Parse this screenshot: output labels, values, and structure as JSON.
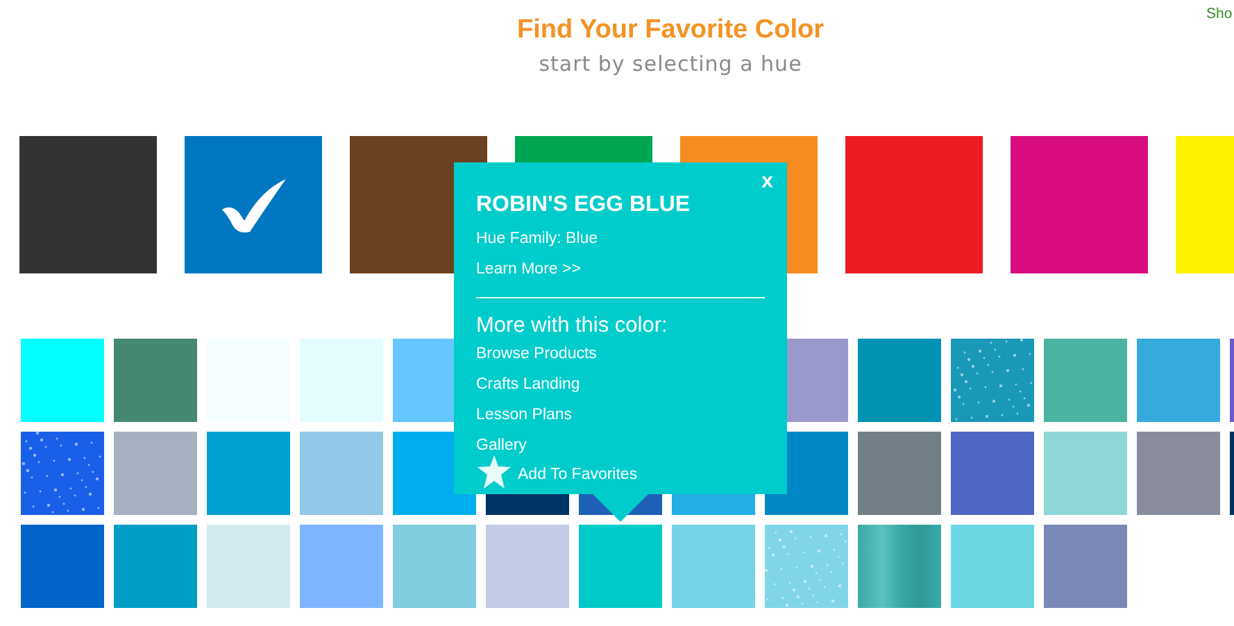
{
  "header": {
    "title": "Find Your Favorite Color",
    "subtitle": "start by selecting a hue",
    "corner_link": "Sho"
  },
  "hues": [
    {
      "color": "#333333",
      "selected": false
    },
    {
      "color": "#0077c0",
      "selected": true
    },
    {
      "color": "#6b4220",
      "selected": false
    },
    {
      "color": "#00a651",
      "selected": false
    },
    {
      "color": "#f68b1f",
      "selected": false
    },
    {
      "color": "#ed1c24",
      "selected": false
    },
    {
      "color": "#d80c80",
      "selected": false
    },
    {
      "color": "#fff200",
      "selected": false
    }
  ],
  "shades": [
    [
      {
        "kind": "solid",
        "color": "#00ffff"
      },
      {
        "kind": "solid",
        "color": "#448870"
      },
      {
        "kind": "solid",
        "color": "#f5feff"
      },
      {
        "kind": "solid",
        "color": "#e3fdff"
      },
      {
        "kind": "solid",
        "color": "#66c6ff"
      },
      {
        "kind": "covered"
      },
      {
        "kind": "covered"
      },
      {
        "kind": "covered"
      },
      {
        "kind": "solid",
        "color": "#9999cc"
      },
      {
        "kind": "solid",
        "color": "#0093b4"
      },
      {
        "kind": "glitter",
        "color": "#1a98b8"
      },
      {
        "kind": "solid",
        "color": "#4bb3a2"
      },
      {
        "kind": "solid",
        "color": "#36aadd"
      },
      {
        "kind": "solid",
        "color": "#6a5acd"
      }
    ],
    [
      {
        "kind": "glitter",
        "color": "#1a5fe8"
      },
      {
        "kind": "solid",
        "color": "#a6b0c0"
      },
      {
        "kind": "solid",
        "color": "#00a0d2"
      },
      {
        "kind": "solid",
        "color": "#92c8e8"
      },
      {
        "kind": "solid",
        "color": "#00aeef"
      },
      {
        "kind": "solid",
        "color": "#003366"
      },
      {
        "kind": "solid",
        "color": "#1e5fb8"
      },
      {
        "kind": "solid",
        "color": "#22aee6"
      },
      {
        "kind": "solid",
        "color": "#0088c6"
      },
      {
        "kind": "solid",
        "color": "#737f86"
      },
      {
        "kind": "solid",
        "color": "#4f67c4"
      },
      {
        "kind": "solid",
        "color": "#8fd6d6"
      },
      {
        "kind": "solid",
        "color": "#898c9c"
      },
      {
        "kind": "solid",
        "color": "#003060"
      }
    ],
    [
      {
        "kind": "solid",
        "color": "#0064c8"
      },
      {
        "kind": "solid",
        "color": "#009ec6"
      },
      {
        "kind": "solid",
        "color": "#d2ebf0"
      },
      {
        "kind": "solid",
        "color": "#7fb5ff"
      },
      {
        "kind": "solid",
        "color": "#80cde0"
      },
      {
        "kind": "solid",
        "color": "#c2cbe4"
      },
      {
        "kind": "solid",
        "color": "#00cbc8",
        "popup": {
          "title": "ROBIN'S EGG BLUE",
          "close": "x",
          "hue_family": "Hue Family: Blue",
          "learn_more": "Learn More >>",
          "more_heading": "More with this color:",
          "links": [
            "Browse Products",
            "Crafts Landing",
            "Lesson Plans",
            "Gallery"
          ],
          "favorite": "Add To Favorites"
        }
      },
      {
        "kind": "solid",
        "color": "#74d3e6"
      },
      {
        "kind": "glitter",
        "color": "#80d6e8"
      },
      {
        "kind": "metallic",
        "color": "#39aaa8"
      },
      {
        "kind": "solid",
        "color": "#6ad7e3"
      },
      {
        "kind": "solid",
        "color": "#7a88b8"
      }
    ]
  ]
}
